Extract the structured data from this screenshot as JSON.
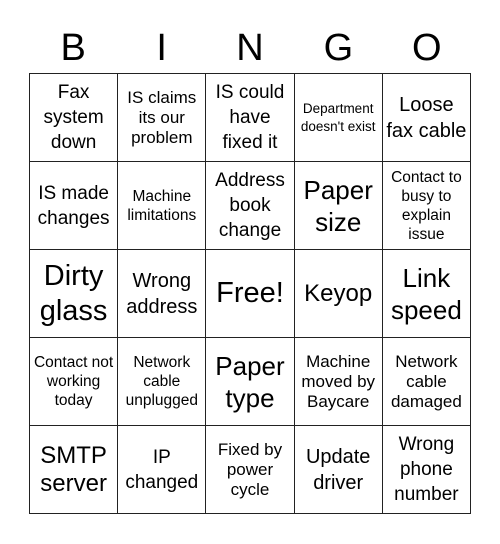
{
  "header": [
    "B",
    "I",
    "N",
    "G",
    "O"
  ],
  "cells": [
    {
      "text": "Fax system down",
      "size": "s19"
    },
    {
      "text": "IS claims its our problem",
      "size": "s17"
    },
    {
      "text": "IS could have fixed it",
      "size": "s19"
    },
    {
      "text": "Department doesn't exist",
      "size": "s13"
    },
    {
      "text": "Loose fax cable",
      "size": "s20"
    },
    {
      "text": "IS made changes",
      "size": "s19"
    },
    {
      "text": "Machine limitations",
      "size": "s15"
    },
    {
      "text": "Address book change",
      "size": "s19"
    },
    {
      "text": "Paper size",
      "size": "s26"
    },
    {
      "text": "Contact to busy to explain issue",
      "size": "s15"
    },
    {
      "text": "Dirty glass",
      "size": "s28"
    },
    {
      "text": "Wrong address",
      "size": "s20"
    },
    {
      "text": "Free!",
      "size": "s28"
    },
    {
      "text": "Keyop",
      "size": "s24"
    },
    {
      "text": "Link speed",
      "size": "s26"
    },
    {
      "text": "Contact not working today",
      "size": "s15"
    },
    {
      "text": "Network cable unplugged",
      "size": "s15"
    },
    {
      "text": "Paper type",
      "size": "s26"
    },
    {
      "text": "Machine moved by Baycare",
      "size": "s17"
    },
    {
      "text": "Network cable damaged",
      "size": "s17"
    },
    {
      "text": "SMTP server",
      "size": "s24"
    },
    {
      "text": "IP changed",
      "size": "s19"
    },
    {
      "text": "Fixed by power cycle",
      "size": "s17"
    },
    {
      "text": "Update driver",
      "size": "s20"
    },
    {
      "text": "Wrong phone number",
      "size": "s19"
    }
  ]
}
